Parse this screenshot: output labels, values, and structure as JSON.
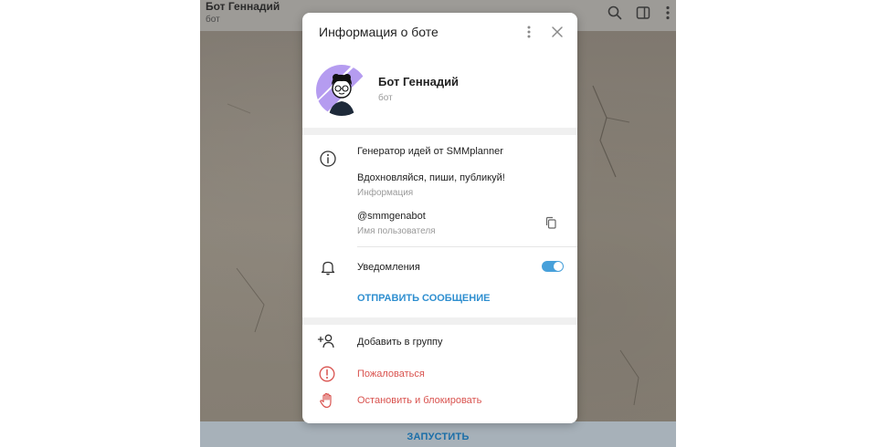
{
  "chat": {
    "title": "Бот Геннадий",
    "subtitle": "бот",
    "start_label": "ЗАПУСТИТЬ",
    "header_icons": [
      "search-icon",
      "sidebar-toggle-icon",
      "more-vert-icon"
    ]
  },
  "modal": {
    "title": "Информация о боте",
    "bot": {
      "name": "Бот Геннадий",
      "subtitle": "бот"
    },
    "info": {
      "description": "Генератор идей от SMMplanner",
      "about": "Вдохновляйся, пиши, публикуй!",
      "about_label": "Информация",
      "username": "@smmgenabot",
      "username_label": "Имя пользователя"
    },
    "notifications": {
      "label": "Уведомления",
      "enabled": true
    },
    "send_message_label": "ОТПРАВИТЬ СООБЩЕНИЕ",
    "actions": {
      "add_to_group": "Добавить в группу",
      "report": "Пожаловаться",
      "block": "Остановить и блокировать"
    }
  },
  "colors": {
    "accent": "#2f8fd0",
    "toggle": "#47a0da",
    "danger": "#d9534f",
    "avatar_bg": "#b59cf0"
  }
}
